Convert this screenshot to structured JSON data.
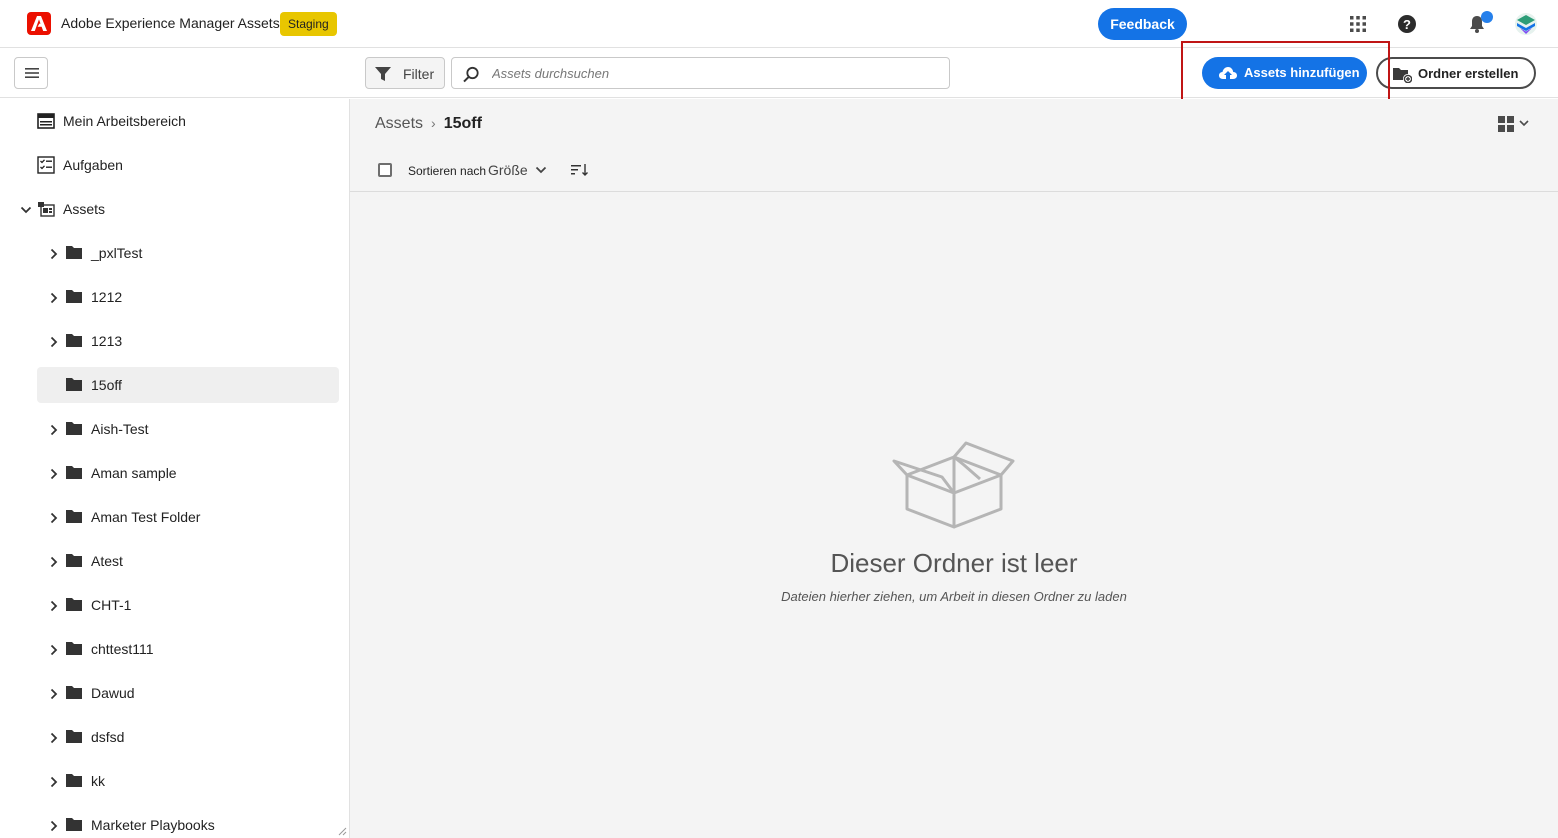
{
  "header": {
    "app_title": "Adobe Experience Manager Assets",
    "env_badge": "Staging",
    "feedback_label": "Feedback",
    "icons": [
      "app-switcher-icon",
      "help-icon",
      "notification-bell-icon",
      "user-avatar"
    ],
    "accent_color": "#1473e6",
    "badge_color": "#e8c600"
  },
  "toolbar": {
    "filter_label": "Filter",
    "search_placeholder": "Assets durchsuchen",
    "add_assets_label": "Assets hinzufügen",
    "create_folder_label": "Ordner erstellen"
  },
  "sidebar": {
    "workspace_label": "Mein Arbeitsbereich",
    "tasks_label": "Aufgaben",
    "assets_label": "Assets",
    "folders": [
      {
        "label": "_pxlTest",
        "expandable": true,
        "selected": false
      },
      {
        "label": "1212",
        "expandable": true,
        "selected": false
      },
      {
        "label": "1213",
        "expandable": true,
        "selected": false
      },
      {
        "label": "15off",
        "expandable": false,
        "selected": true
      },
      {
        "label": "Aish-Test",
        "expandable": true,
        "selected": false
      },
      {
        "label": "Aman sample",
        "expandable": true,
        "selected": false
      },
      {
        "label": "Aman Test Folder",
        "expandable": true,
        "selected": false
      },
      {
        "label": "Atest",
        "expandable": true,
        "selected": false
      },
      {
        "label": "CHT-1",
        "expandable": true,
        "selected": false
      },
      {
        "label": "chttest111",
        "expandable": true,
        "selected": false
      },
      {
        "label": "Dawud",
        "expandable": true,
        "selected": false
      },
      {
        "label": "dsfsd",
        "expandable": true,
        "selected": false
      },
      {
        "label": "kk",
        "expandable": true,
        "selected": false
      },
      {
        "label": "Marketer Playbooks",
        "expandable": true,
        "selected": false
      }
    ]
  },
  "main": {
    "breadcrumb_root": "Assets",
    "breadcrumb_current": "15off",
    "sort_label": "Sortieren nach",
    "sort_value": "Größe",
    "empty_title": "Dieser Ordner ist leer",
    "empty_subtitle": "Dateien hierher ziehen, um Arbeit in diesen Ordner zu laden"
  }
}
